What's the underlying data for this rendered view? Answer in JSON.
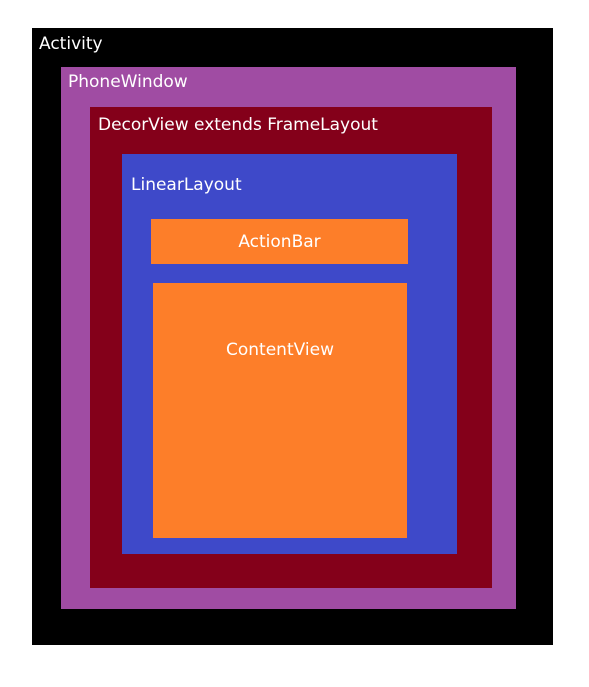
{
  "colors": {
    "activity": "#000000",
    "phone_window": "#a04ca3",
    "decor_view": "#84001a",
    "linear_layout": "#3e49c9",
    "action_bar": "#fd7e29",
    "content_view": "#fd7e29",
    "text": "#ffffff"
  },
  "activity": {
    "label": "Activity"
  },
  "phone_window": {
    "label": "PhoneWindow"
  },
  "decor_view": {
    "label": "DecorView extends FrameLayout"
  },
  "linear_layout": {
    "label": "LinearLayout"
  },
  "action_bar": {
    "label": "ActionBar"
  },
  "content_view": {
    "label": "ContentView"
  }
}
